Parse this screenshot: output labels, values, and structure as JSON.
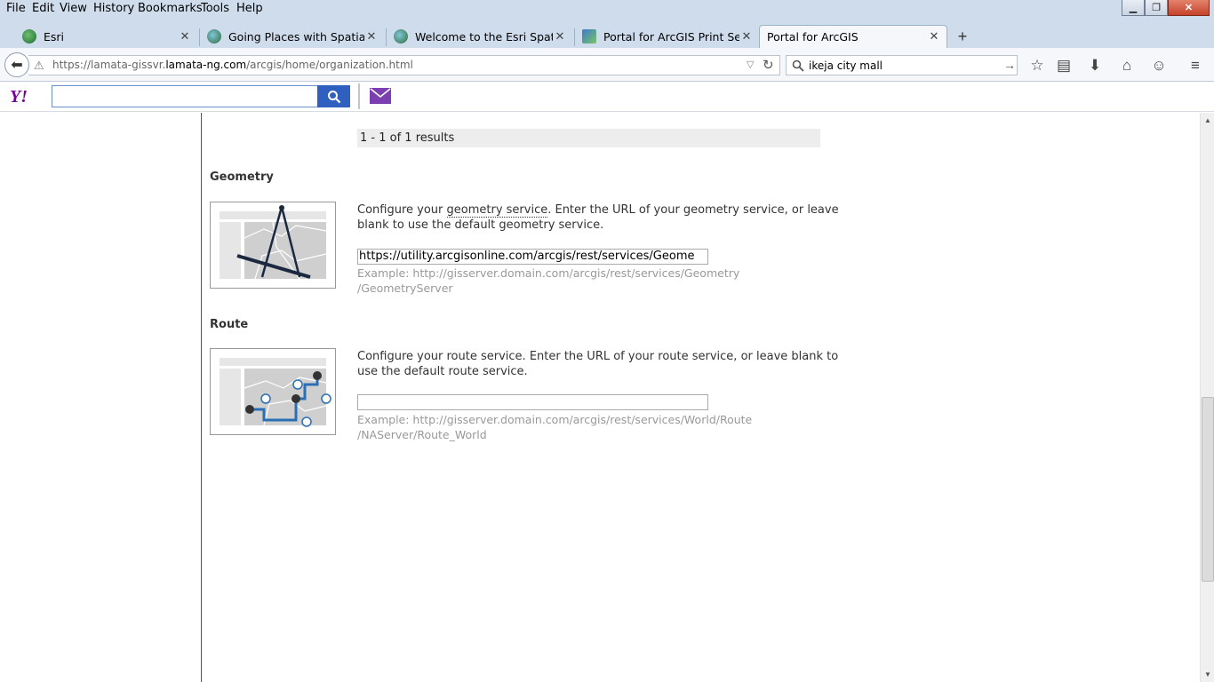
{
  "menubar": {
    "items": [
      "File",
      "Edit",
      "View",
      "History",
      "Bookmarks",
      "Tools",
      "Help"
    ]
  },
  "tabs": [
    {
      "label": "Esri",
      "icon": "esri-globe-icon",
      "active": false
    },
    {
      "label": "Going Places with Spatial A...",
      "icon": "globe-icon",
      "active": false
    },
    {
      "label": "Welcome to the Esri Spatial...",
      "icon": "globe-icon",
      "active": false
    },
    {
      "label": "Portal for ArcGIS Print Servi...",
      "icon": "portal-map-icon",
      "active": false
    },
    {
      "label": "Portal for ArcGIS",
      "icon": "",
      "active": true
    }
  ],
  "navbar": {
    "url_prefix": "https://lamata-gissvr.",
    "url_domain": "lamata-ng.com",
    "url_suffix": "/arcgis/home/organization.html",
    "search_value": "ikeja city mall"
  },
  "colors": {
    "chrome_bg": "#cfdcec",
    "yahoo_purple": "#7b0099",
    "yahoo_blue": "#2f5fbf",
    "results_bg": "#ededed"
  },
  "content": {
    "results_text": "1 - 1 of 1 results",
    "geometry": {
      "title": "Geometry",
      "desc_before": "Configure your ",
      "desc_link": "geometry service",
      "desc_after": ". Enter the URL of your geometry service, or leave blank to use the default geometry service.",
      "input_value": "https://utility.arcgisonline.com/arcgis/rest/services/Geome",
      "example_line1": "Example: http://gisserver.domain.com/arcgis/rest/services/Geometry",
      "example_line2": "/GeometryServer"
    },
    "route": {
      "title": "Route",
      "desc": "Configure your route service. Enter the URL of your route service, or leave blank to use the default route service.",
      "input_value": "",
      "example_line1": "Example: http://gisserver.domain.com/arcgis/rest/services/World/Route",
      "example_line2": "/NAServer/Route_World"
    }
  }
}
